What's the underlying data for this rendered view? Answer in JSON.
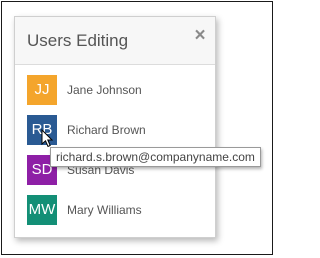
{
  "panel": {
    "title": "Users Editing",
    "close_glyph": "×"
  },
  "users": [
    {
      "initials": "JJ",
      "name": "Jane Johnson",
      "color": "#f4a52c"
    },
    {
      "initials": "RB",
      "name": "Richard Brown",
      "color": "#2a5a93"
    },
    {
      "initials": "SD",
      "name": "Susan Davis",
      "color": "#8e1fa6"
    },
    {
      "initials": "MW",
      "name": "Mary Williams",
      "color": "#138f76"
    }
  ],
  "tooltip": {
    "text": "richard.s.brown@companyname.com"
  },
  "icons": {
    "close": "close-icon",
    "cursor": "mouse-pointer-icon"
  }
}
